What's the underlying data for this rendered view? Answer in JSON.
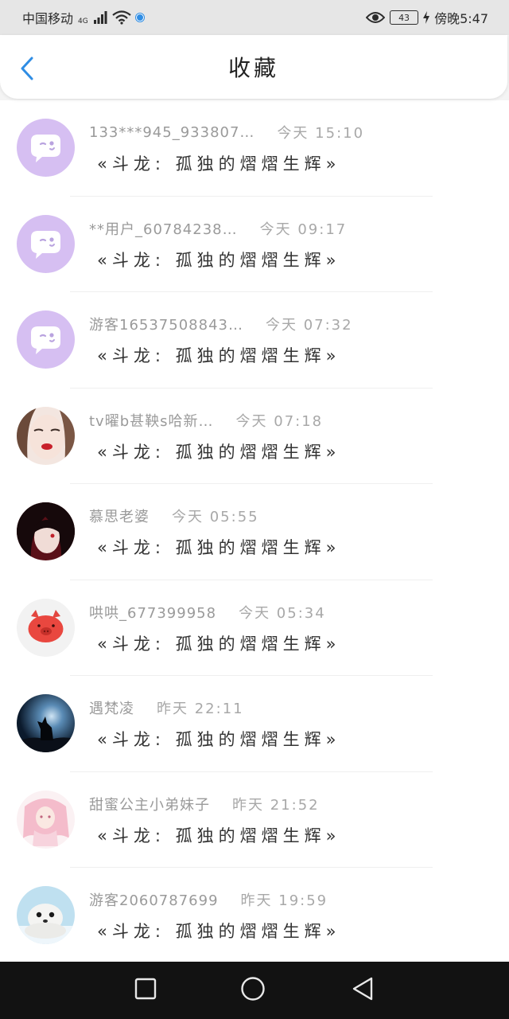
{
  "status_bar": {
    "carrier": "中国移动",
    "network": "4G",
    "battery": "43",
    "time": "傍晚5:47",
    "icons": [
      "signal-icon",
      "wifi-icon",
      "notification-dot-icon",
      "eye-comfort-icon",
      "battery-icon",
      "charging-icon"
    ]
  },
  "header": {
    "title": "收藏",
    "back_icon": "chevron-left-icon"
  },
  "colors": {
    "accent": "#2f8de4",
    "placeholder_avatar": "#d6bff2"
  },
  "favorites": [
    {
      "username": "133***945_933807…",
      "time": "今天 15:10",
      "title": "«斗龙: 孤独的熠熠生辉»",
      "avatar": "chat-bubble-avatar"
    },
    {
      "username": "**用户_60784238…",
      "time": "今天 09:17",
      "title": "«斗龙: 孤独的熠熠生辉»",
      "avatar": "chat-bubble-avatar"
    },
    {
      "username": "游客16537508843…",
      "time": "今天 07:32",
      "title": "«斗龙: 孤独的熠熠生辉»",
      "avatar": "chat-bubble-avatar"
    },
    {
      "username": "tv曜b甚鞅s哈新…",
      "time": "今天 07:18",
      "title": "«斗龙: 孤独的熠熠生辉»",
      "avatar": "woman-face-avatar"
    },
    {
      "username": "慕思老婆",
      "time": "今天 05:55",
      "title": "«斗龙: 孤独的熠熠生辉»",
      "avatar": "anime-girl-avatar"
    },
    {
      "username": "哄哄_677399958",
      "time": "今天 05:34",
      "title": "«斗龙: 孤独的熠熠生辉»",
      "avatar": "pig-avatar"
    },
    {
      "username": "遇梵凌",
      "time": "昨天 22:11",
      "title": "«斗龙: 孤独的熠熠生辉»",
      "avatar": "wolf-moon-avatar"
    },
    {
      "username": "甜蜜公主小弟妹子",
      "time": "昨天 21:52",
      "title": "«斗龙: 孤独的熠熠生辉»",
      "avatar": "pink-anime-avatar"
    },
    {
      "username": "游客2060787699",
      "time": "昨天 19:59",
      "title": "«斗龙: 孤独的熠熠生辉»",
      "avatar": "seal-avatar"
    }
  ],
  "nav_bar": {
    "buttons": [
      "recent-apps-icon",
      "home-icon",
      "back-triangle-icon"
    ]
  }
}
